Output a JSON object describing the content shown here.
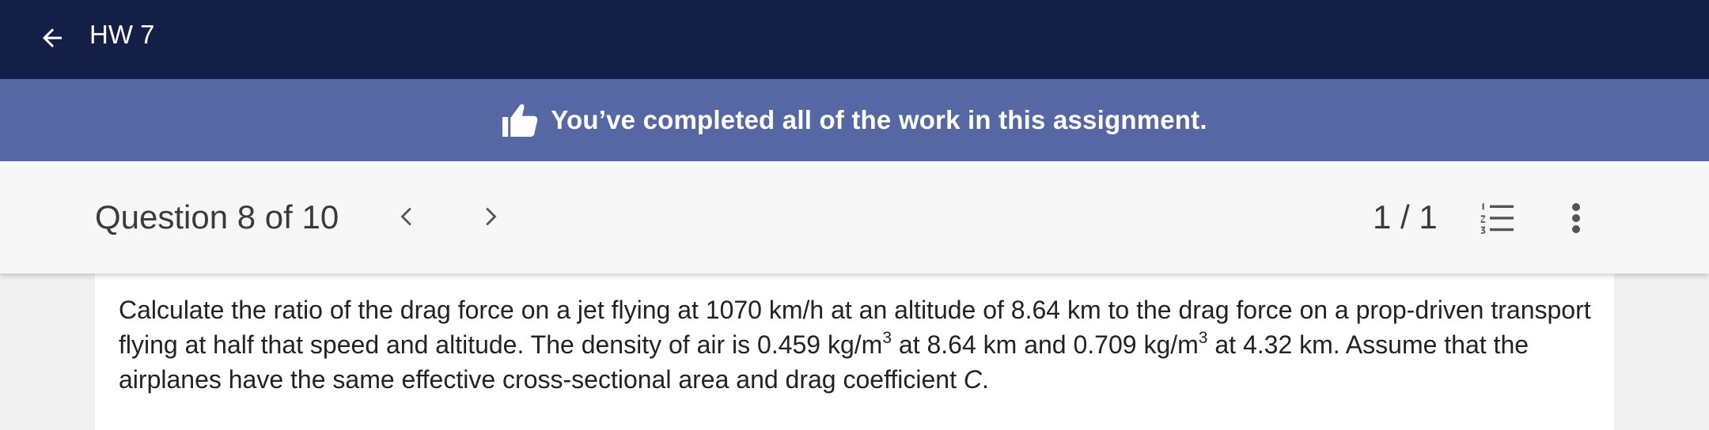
{
  "app": {
    "title": "HW 7"
  },
  "banner": {
    "message": "You’ve completed all of the work in this assignment."
  },
  "question_bar": {
    "title": "Question 8 of 10",
    "page_count": "1 / 1"
  },
  "question": {
    "part1": "Calculate the ratio of the drag force on a jet flying at 1070 km/h at an altitude of 8.64 km to the drag force on a prop-driven transport flying at half that speed and altitude. The density of air is 0.459 kg/m",
    "sup1": "3",
    "part2": " at 8.64 km and 0.709 kg/m",
    "sup2": "3",
    "part3": " at 4.32 km. Assume that the airplanes have the same effective cross-sectional area and drag coefficient ",
    "var_c": "C",
    "part4": "."
  },
  "icons": {
    "back": "arrow-left-icon",
    "banner": "thumbs-up-icon",
    "prev": "chevron-left-icon",
    "next": "chevron-right-icon",
    "list": "numbered-list-icon",
    "more": "more-vertical-icon"
  },
  "colors": {
    "topbar": "#141f47",
    "banner": "#5668a3",
    "question_bar": "#f7f7f7",
    "page_bg": "#f0f0f0",
    "content_bg": "#ffffff"
  }
}
